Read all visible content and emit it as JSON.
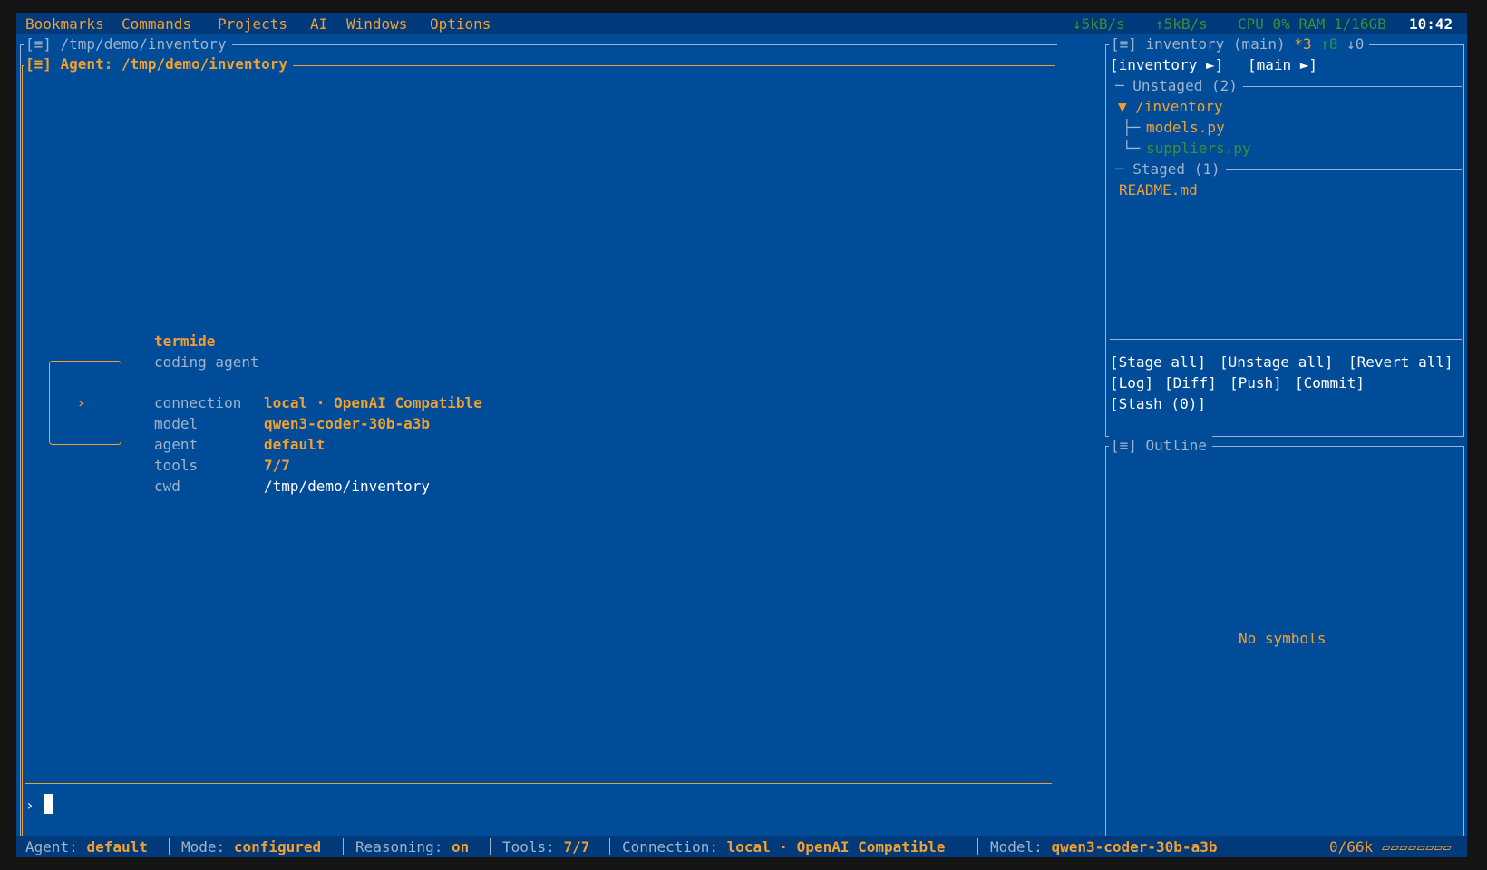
{
  "menubar": {
    "items": [
      "Bookmarks",
      "Commands",
      "Projects",
      "AI",
      "Windows",
      "Options"
    ],
    "net_down": "↓5kB/s",
    "net_up": "↑5kB/s",
    "system": "CPU 0% RAM 1/16GB",
    "clock": "10:42"
  },
  "outer_panel": {
    "title": "[≡] /tmp/demo/inventory"
  },
  "agent_panel": {
    "title": "[≡] Agent: /tmp/demo/inventory",
    "logo_glyph": "›_",
    "app_name": "termide",
    "app_subtitle": "coding agent",
    "info": [
      {
        "key": "connection",
        "value": "local · OpenAI Compatible"
      },
      {
        "key": "model",
        "value": "qwen3-coder-30b-a3b"
      },
      {
        "key": "agent",
        "value": "default"
      },
      {
        "key": "tools",
        "value": "7/7"
      },
      {
        "key": "cwd",
        "value": "/tmp/demo/inventory"
      }
    ],
    "prompt_symbol": "›"
  },
  "git_panel": {
    "title_prefix": "[≡] inventory (main)",
    "modified": "*3",
    "ahead": "↑8",
    "behind": "↓0",
    "repo_button": "[inventory ►]",
    "branch_button": "[main ►]",
    "unstaged_header": "Unstaged (2)",
    "folder": "▼ /inventory",
    "unstaged_files": [
      {
        "branch": "├─",
        "name": "models.py"
      },
      {
        "branch": "└─",
        "name": "suppliers.py"
      }
    ],
    "staged_header": "Staged (1)",
    "staged_files": [
      "README.md"
    ],
    "actions_row1": [
      "[Stage all]",
      "[Unstage all]",
      "[Revert all]"
    ],
    "actions_row2": [
      "[Log]",
      "[Diff]",
      "[Push]",
      "[Commit]"
    ],
    "actions_row3": [
      "[Stash (0)]"
    ]
  },
  "outline_panel": {
    "title": "[≡] Outline",
    "empty_message": "No symbols"
  },
  "statusbar": {
    "agent_label": "Agent:",
    "agent_value": "default",
    "mode_label": "Mode:",
    "mode_value": "configured",
    "reasoning_label": "Reasoning:",
    "reasoning_value": "on",
    "tools_label": "Tools:",
    "tools_value": "7/7",
    "connection_label": "Connection:",
    "connection_value": "local · OpenAI Compatible",
    "model_label": "Model:",
    "model_value": "qwen3-coder-30b-a3b",
    "context": "0/66k",
    "context_bar": "▱▱▱▱▱▱▱▱"
  },
  "colors": {
    "background": "#004c99",
    "accent": "#f0a030",
    "bar": "#003a7a",
    "positive": "#3f8c3a"
  }
}
